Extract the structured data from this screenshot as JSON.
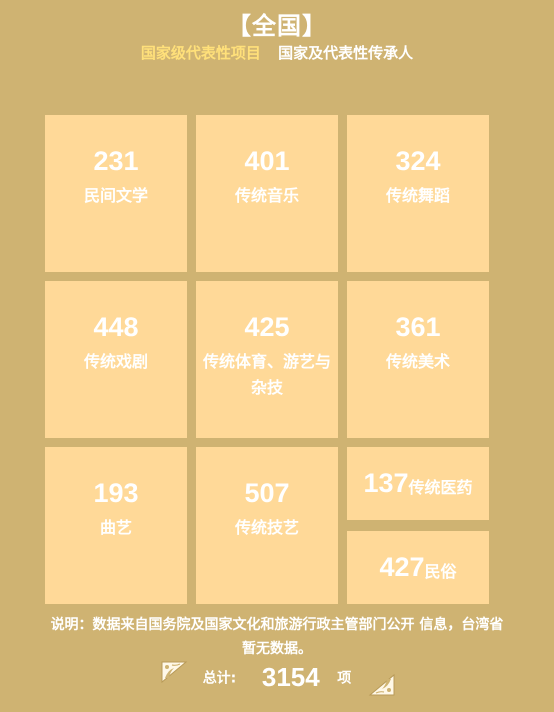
{
  "title": "【全国】",
  "tabs": [
    {
      "label": "国家级代表性项目",
      "active": true
    },
    {
      "label": "国家及代表性传承人",
      "active": false
    }
  ],
  "cards": [
    {
      "value": "231",
      "label": "民间文学"
    },
    {
      "value": "401",
      "label": "传统音乐"
    },
    {
      "value": "324",
      "label": "传统舞蹈"
    },
    {
      "value": "448",
      "label": "传统戏剧"
    },
    {
      "value": "425",
      "label": "传统体育、游艺与杂技"
    },
    {
      "value": "361",
      "label": "传统美术"
    },
    {
      "value": "193",
      "label": "曲艺"
    },
    {
      "value": "507",
      "label": "传统技艺"
    },
    {
      "value": "137",
      "label": "传统医药"
    },
    {
      "value": "427",
      "label": "民俗"
    }
  ],
  "note": "说明：数据来自国务院及国家文化和旅游行政主管部门公开 信息，台湾省暂无数据。",
  "total": {
    "label": "总计:",
    "value": "3154",
    "unit": "项"
  },
  "colors": {
    "background": "#cfb372",
    "card": "#ffd998",
    "active_tab": "#ffe07a"
  },
  "icons": {
    "left": "corner-ornament-icon",
    "right": "corner-ornament-icon"
  }
}
